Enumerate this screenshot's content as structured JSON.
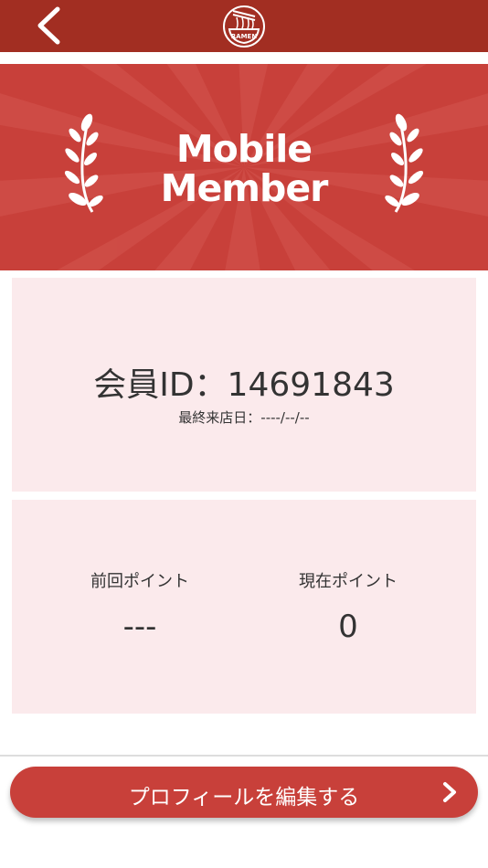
{
  "header": {
    "back_icon": "chevron-left-icon",
    "logo_text": "RAMEN",
    "logo_icon": "ramen-bowl-logo"
  },
  "banner": {
    "line1": "Mobile",
    "line2": "Member",
    "icons": [
      "laurel-left-icon",
      "laurel-right-icon"
    ]
  },
  "member": {
    "id_text": "会員ID：14691843",
    "last_visit": "最終来店日：----/--/--"
  },
  "points": {
    "previous_label": "前回ポイント",
    "previous_value": "---",
    "current_label": "現在ポイント",
    "current_value": "0"
  },
  "footer": {
    "edit_label": "プロフィールを編集する",
    "edit_icon": "chevron-right-icon"
  },
  "colors": {
    "header_bg": "#a22e22",
    "banner_bg": "#c8403a",
    "card_bg": "#fbeaec",
    "button_bg": "#c8403a"
  }
}
